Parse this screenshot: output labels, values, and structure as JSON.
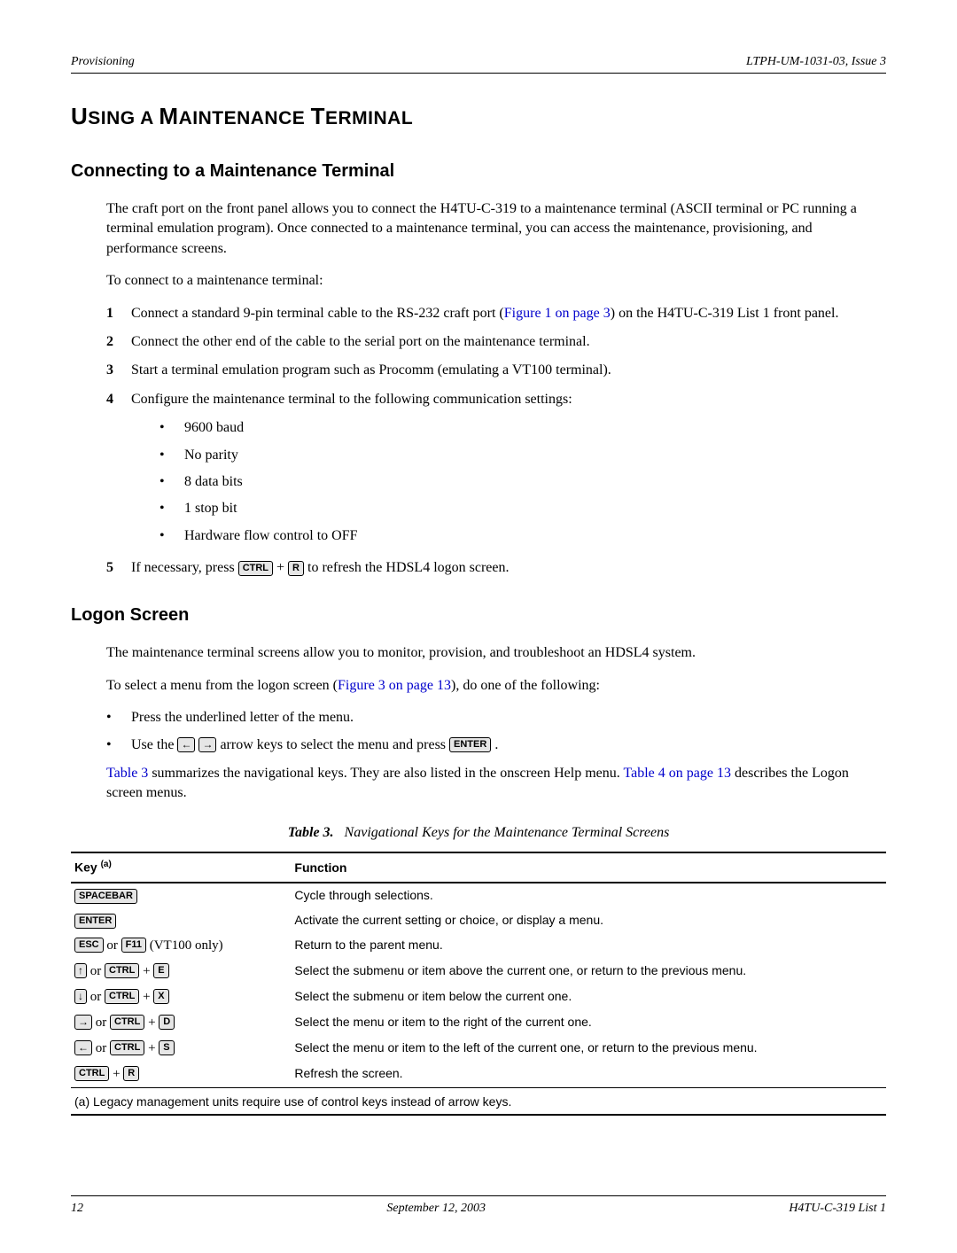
{
  "header": {
    "left": "Provisioning",
    "right": "LTPH-UM-1031-03, Issue 3"
  },
  "section_title_parts": {
    "p1": "U",
    "p2": "SING A ",
    "p3": "M",
    "p4": "AINTENANCE ",
    "p5": "T",
    "p6": "ERMINAL"
  },
  "sub1": {
    "heading": "Connecting to a Maintenance Terminal",
    "para1": "The craft port on the front panel allows you to connect the H4TU-C-319 to a maintenance terminal (ASCII terminal or PC running a terminal emulation program). Once connected to a maintenance terminal, you can access the maintenance, provisioning, and performance screens.",
    "para2": "To connect to a maintenance terminal:",
    "step1a": "Connect a standard 9-pin terminal cable to the RS-232 craft port (",
    "step1_link": "Figure 1 on page 3",
    "step1b": ") on the H4TU-C-319 List 1 front panel.",
    "step2": "Connect the other end of the cable to the serial port on the maintenance terminal.",
    "step3": "Start a terminal emulation program such as Procomm (emulating a VT100 terminal).",
    "step4": "Configure the maintenance terminal to the following communication settings:",
    "bullets": {
      "b1": "9600 baud",
      "b2": "No parity",
      "b3": "8 data bits",
      "b4": "1 stop bit",
      "b5": "Hardware flow control to OFF"
    },
    "step5a": "If necessary, press ",
    "step5b": " to refresh the HDSL4 logon screen."
  },
  "sub2": {
    "heading": "Logon Screen",
    "para1": "The maintenance terminal screens allow you to monitor, provision, and troubleshoot an HDSL4 system.",
    "para2a": "To select a menu from the logon screen (",
    "para2_link": "Figure 3 on page 13",
    "para2b": "), do one of the following:",
    "bullet1": "Press the underlined letter of the menu.",
    "bullet2a": "Use the ",
    "bullet2b": " arrow keys to select the menu and press ",
    "bullet2c": ".",
    "para3_link1": "Table 3",
    "para3a": " summarizes the navigational keys. They are also listed in the onscreen Help menu. ",
    "para3_link2": "Table 4 on page 13",
    "para3b": " describes the Logon screen menus."
  },
  "table": {
    "caption_label": "Table 3.",
    "caption_title": "Navigational Keys for the Maintenance Terminal Screens",
    "head_key": "Key ",
    "head_key_sup": "(a)",
    "head_func": "Function",
    "rows": {
      "r1_func": "Cycle through selections.",
      "r2_func": "Activate the current setting or choice, or display a menu.",
      "r3_suffix": " (VT100 only)",
      "r3_func": "Return to the parent menu.",
      "r4_func": "Select the submenu or item above the current one, or return to the previous menu.",
      "r5_func": "Select the submenu or item below the current one.",
      "r6_func": "Select the menu or item to the right of the current one.",
      "r7_func": "Select the menu or item to the left of the current one, or return to the previous menu.",
      "r8_func": "Refresh the screen."
    },
    "footnote": "(a) Legacy management units require use of control keys instead of arrow keys."
  },
  "keys": {
    "ctrl": "CTRL",
    "r": "R",
    "spacebar": "SPACEBAR",
    "enter": "ENTER",
    "esc": "ESC",
    "f11": "F11",
    "e": "E",
    "x": "X",
    "d": "D",
    "s": "S",
    "plus": " + ",
    "or": " or ",
    "up": "↑",
    "down": "↓",
    "right": "→",
    "left": "←"
  },
  "footer": {
    "page": "12",
    "date": "September 12, 2003",
    "model": "H4TU-C-319 List 1"
  }
}
